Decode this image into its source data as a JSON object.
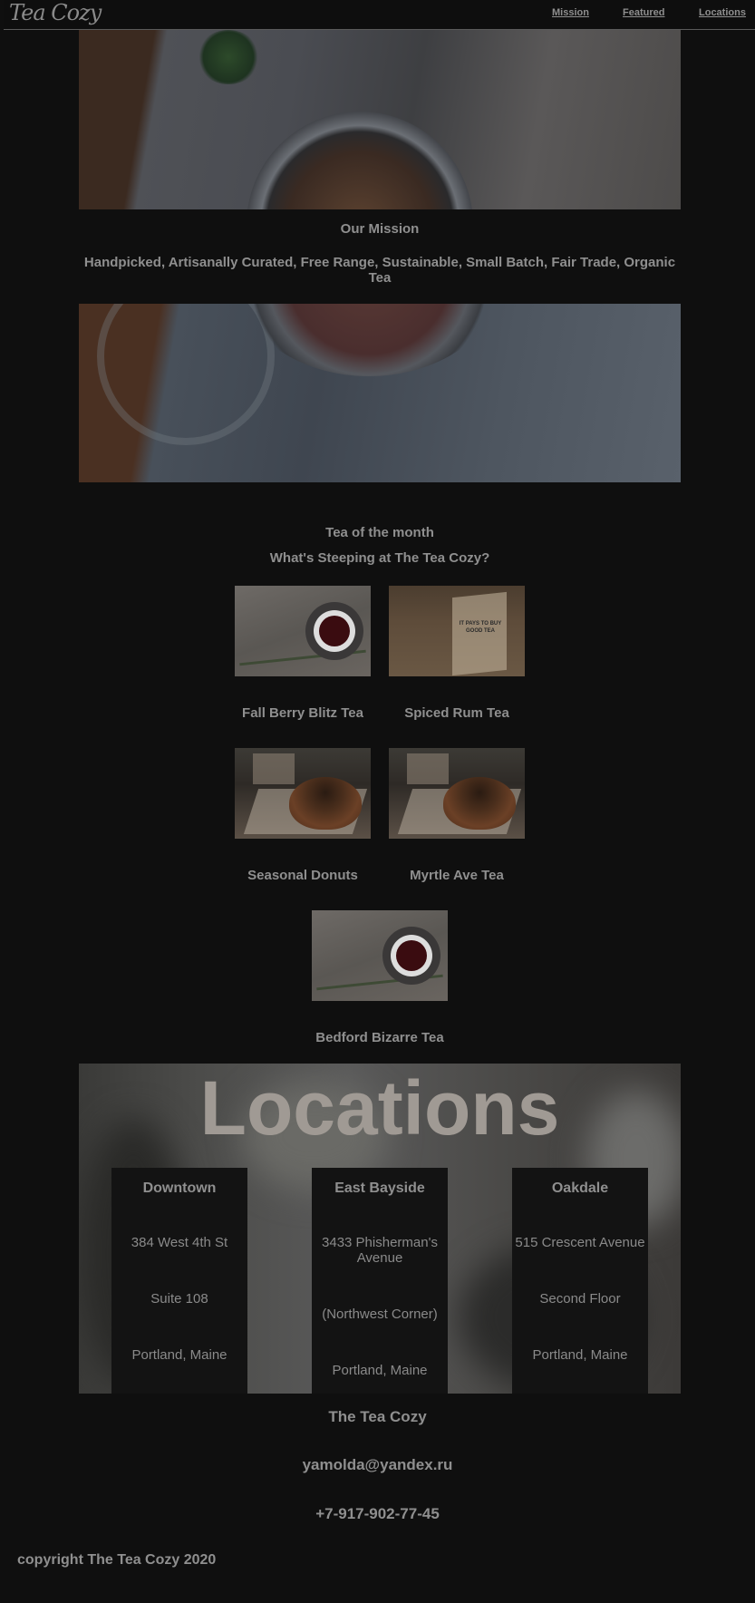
{
  "header": {
    "logo": "Tea Cozy",
    "nav": [
      "Mission",
      "Featured",
      "Locations"
    ]
  },
  "mission": {
    "title": "Our Mission",
    "tagline": "Handpicked, Artisanally Curated, Free Range, Sustainable, Small Batch, Fair Trade, Organic Tea"
  },
  "featured": {
    "title": "Tea of the month",
    "subtitle": "What's Steeping at The Tea Cozy?",
    "items": [
      {
        "name": "Fall Berry Blitz Tea"
      },
      {
        "name": "Spiced Rum Tea",
        "box_text": "IT PAYS TO BUY GOOD TEA"
      },
      {
        "name": "Seasonal Donuts"
      },
      {
        "name": "Myrtle Ave Tea"
      },
      {
        "name": "Bedford Bizarre Tea"
      }
    ]
  },
  "locations": {
    "title": "Locations",
    "items": [
      {
        "name": "Downtown",
        "lines": [
          "384 West 4th St",
          "Suite 108",
          "Portland, Maine"
        ]
      },
      {
        "name": "East Bayside",
        "lines": [
          "3433 Phisherman's Avenue",
          "(Northwest Corner)",
          "Portland, Maine"
        ]
      },
      {
        "name": "Oakdale",
        "lines": [
          "515 Crescent Avenue",
          "Second Floor",
          "Portland, Maine"
        ]
      }
    ]
  },
  "footer": {
    "name": "The Tea Cozy",
    "email": "yamolda@yandex.ru",
    "phone": "+7-917-902-77-45",
    "copyright": "copyright The Tea Cozy 2020"
  }
}
